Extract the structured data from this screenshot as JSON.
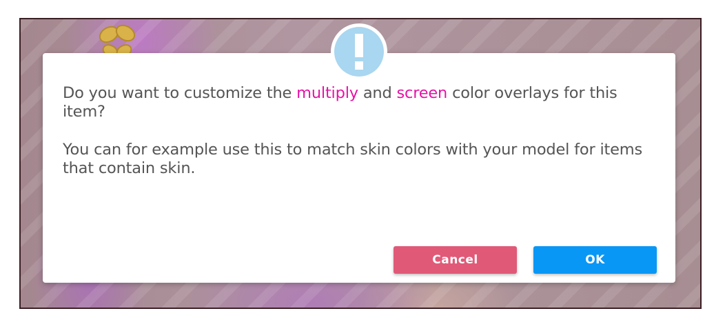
{
  "dialog": {
    "message": {
      "line1_pre": "Do you want to customize the ",
      "highlight1": "multiply",
      "line1_mid": " and ",
      "highlight2": "screen",
      "line1_post": " color overlays for this item?",
      "line2": "You can for example use this to match skin colors with your model for items that contain skin."
    },
    "icon": "exclamation-icon",
    "buttons": {
      "cancel_label": "Cancel",
      "ok_label": "OK"
    }
  },
  "colors": {
    "accent_text": "#e612a6",
    "cancel_button": "#e05a78",
    "ok_button": "#0997f6",
    "alert_icon_bg": "#a9d6f0"
  }
}
